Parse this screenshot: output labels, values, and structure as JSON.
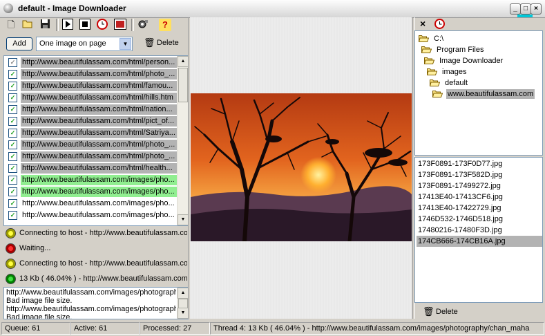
{
  "window": {
    "title": "default - Image Downloader"
  },
  "toolbar": {
    "icons": [
      "new-icon",
      "open-icon",
      "save-icon",
      "start-icon",
      "stop-icon",
      "scheduler-icon",
      "film-icon",
      "settings-icon",
      "help-icon"
    ]
  },
  "controls": {
    "add_label": "Add",
    "mode_value": "One image on page",
    "delete_label": "Delete"
  },
  "url_list": [
    {
      "url": "http://www.beautifulassam.com/html/person...",
      "state": "sel",
      "check": "dim"
    },
    {
      "url": "http://www.beautifulassam.com/html/photo_...",
      "state": "sel",
      "check": "on"
    },
    {
      "url": "http://www.beautifulassam.com/html/famou...",
      "state": "sel",
      "check": "on"
    },
    {
      "url": "http://www.beautifulassam.com/html/hills.htm",
      "state": "sel",
      "check": "on"
    },
    {
      "url": "http://www.beautifulassam.com/html/nation...",
      "state": "sel",
      "check": "on"
    },
    {
      "url": "http://www.beautifulassam.com/html/pict_of...",
      "state": "sel",
      "check": "on"
    },
    {
      "url": "http://www.beautifulassam.com/html/Satriya...",
      "state": "sel",
      "check": "on"
    },
    {
      "url": "http://www.beautifulassam.com/html/photo_...",
      "state": "sel",
      "check": "on"
    },
    {
      "url": "http://www.beautifulassam.com/html/photo_...",
      "state": "sel",
      "check": "on"
    },
    {
      "url": "http://www.beautifulassam.com/html/health...",
      "state": "sel",
      "check": "on"
    },
    {
      "url": "http://www.beautifulassam.com/images/pho...",
      "state": "green",
      "check": "on"
    },
    {
      "url": "http://www.beautifulassam.com/images/pho...",
      "state": "green",
      "check": "on"
    },
    {
      "url": "http://www.beautifulassam.com/images/pho...",
      "state": "",
      "check": "on"
    },
    {
      "url": "http://www.beautifulassam.com/images/pho...",
      "state": "",
      "check": "on"
    }
  ],
  "threads": [
    {
      "status": "yellow",
      "text": "Connecting to host - http://www.beautifulassam.com"
    },
    {
      "status": "red",
      "text": "Waiting..."
    },
    {
      "status": "yellow",
      "text": "Connecting to host - http://www.beautifulassam.com"
    },
    {
      "status": "green",
      "text": "13 Kb ( 46.04% ) - http://www.beautifulassam.com/"
    }
  ],
  "log": [
    "http://www.beautifulassam.com/images/photograph",
    "Bad image file size.",
    "http://www.beautifulassam.com/images/photograph",
    "Bad image file size."
  ],
  "tree": [
    {
      "label": "C:\\",
      "depth": 0
    },
    {
      "label": "Program Files",
      "depth": 1
    },
    {
      "label": "Image Downloader",
      "depth": 2
    },
    {
      "label": "images",
      "depth": 3
    },
    {
      "label": "default",
      "depth": 4
    },
    {
      "label": "www.beautifulassam.com",
      "depth": 5,
      "selected": true
    }
  ],
  "files": [
    {
      "name": "173F0891-173F0D77.jpg"
    },
    {
      "name": "173F0891-173F582D.jpg"
    },
    {
      "name": "173F0891-17499272.jpg"
    },
    {
      "name": "17413E40-17413CF6.jpg"
    },
    {
      "name": "17413E40-17422729.jpg"
    },
    {
      "name": "1746D532-1746D518.jpg"
    },
    {
      "name": "17480216-17480F3D.jpg"
    },
    {
      "name": "174CB666-174CB16A.jpg",
      "selected": true
    }
  ],
  "right_panel": {
    "delete_label": "Delete"
  },
  "statusbar": {
    "queue": "Queue: 61",
    "active": "Active: 61",
    "processed": "Processed: 27",
    "thread": "Thread 4: 13 Kb ( 46.04% ) - http://www.beautifulassam.com/images/photography/chan_maha"
  },
  "colors": {
    "selection": "#b3b3b3",
    "downloaded": "#90ee90",
    "accent": "#00c8d8"
  }
}
